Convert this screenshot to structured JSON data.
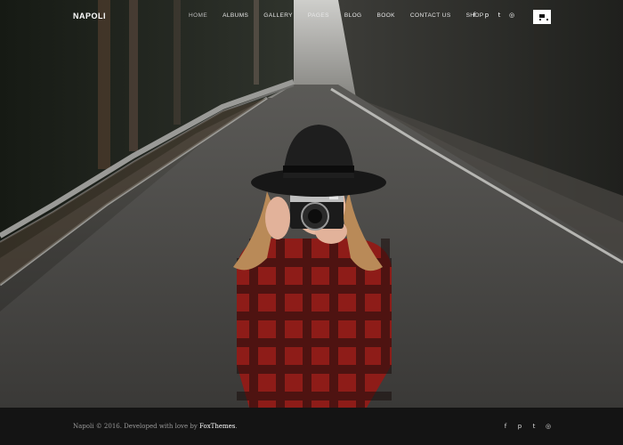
{
  "site": {
    "logo": "NAPOLI"
  },
  "nav": {
    "items": [
      "HOME",
      "ALBUMS",
      "GALLERY",
      "PAGES",
      "BLOG",
      "BOOK",
      "CONTACT US",
      "SHOP"
    ],
    "active": "HOME"
  },
  "social": {
    "icons": [
      "facebook-icon",
      "pinterest-icon",
      "twitter-icon",
      "dribbble-icon"
    ],
    "glyphs": [
      "f",
      "p",
      "t",
      "◎"
    ]
  },
  "cart": {
    "icon": "cart-icon"
  },
  "footer": {
    "copyright_prefix": "Napoli © 2016. Developed with love by",
    "developer": "FoxThemes",
    "copyright_suffix": "."
  },
  "colors": {
    "footer_bg": "#141414",
    "nav_text": "#e8e8e8",
    "shirt_red": "#b3241f"
  }
}
